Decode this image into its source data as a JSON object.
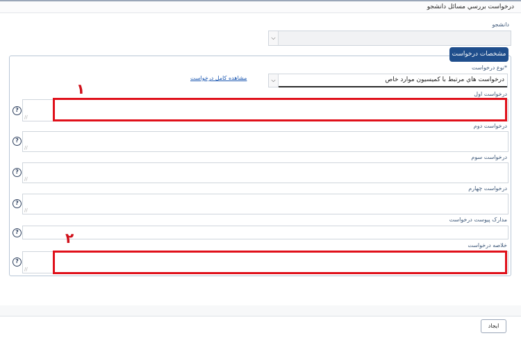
{
  "window": {
    "title": "درخواست بررسي مسائل دانشجو"
  },
  "student": {
    "label": "دانشجو",
    "value": ""
  },
  "section": {
    "legend": "مشخصات درخواست",
    "request_type": {
      "label": "نوع درخواست*",
      "value": "درخواست هاي مرتبط با کميسيون موارد خاص"
    },
    "view_full_link": "مشاهده کامل درخواست",
    "fields": [
      {
        "label": "درخواست اول"
      },
      {
        "label": "درخواست دوم"
      },
      {
        "label": "درخواست سوم"
      },
      {
        "label": "درخواست چهارم"
      },
      {
        "label": "مدارک پيوست درخواست"
      },
      {
        "label": "خلاصه درخواست"
      }
    ],
    "help_glyph": "?"
  },
  "annotations": {
    "mark1": "۱",
    "mark2": "۲"
  },
  "footer": {
    "create_button": "ایجاد"
  },
  "icons": {
    "dropdown": "chevron-down-icon",
    "help": "help-circle-icon",
    "resize": "resize-grip-icon"
  },
  "colors": {
    "legend_bg": "#1f4e8c",
    "highlight": "#e0101a",
    "link": "#1a56b0"
  }
}
